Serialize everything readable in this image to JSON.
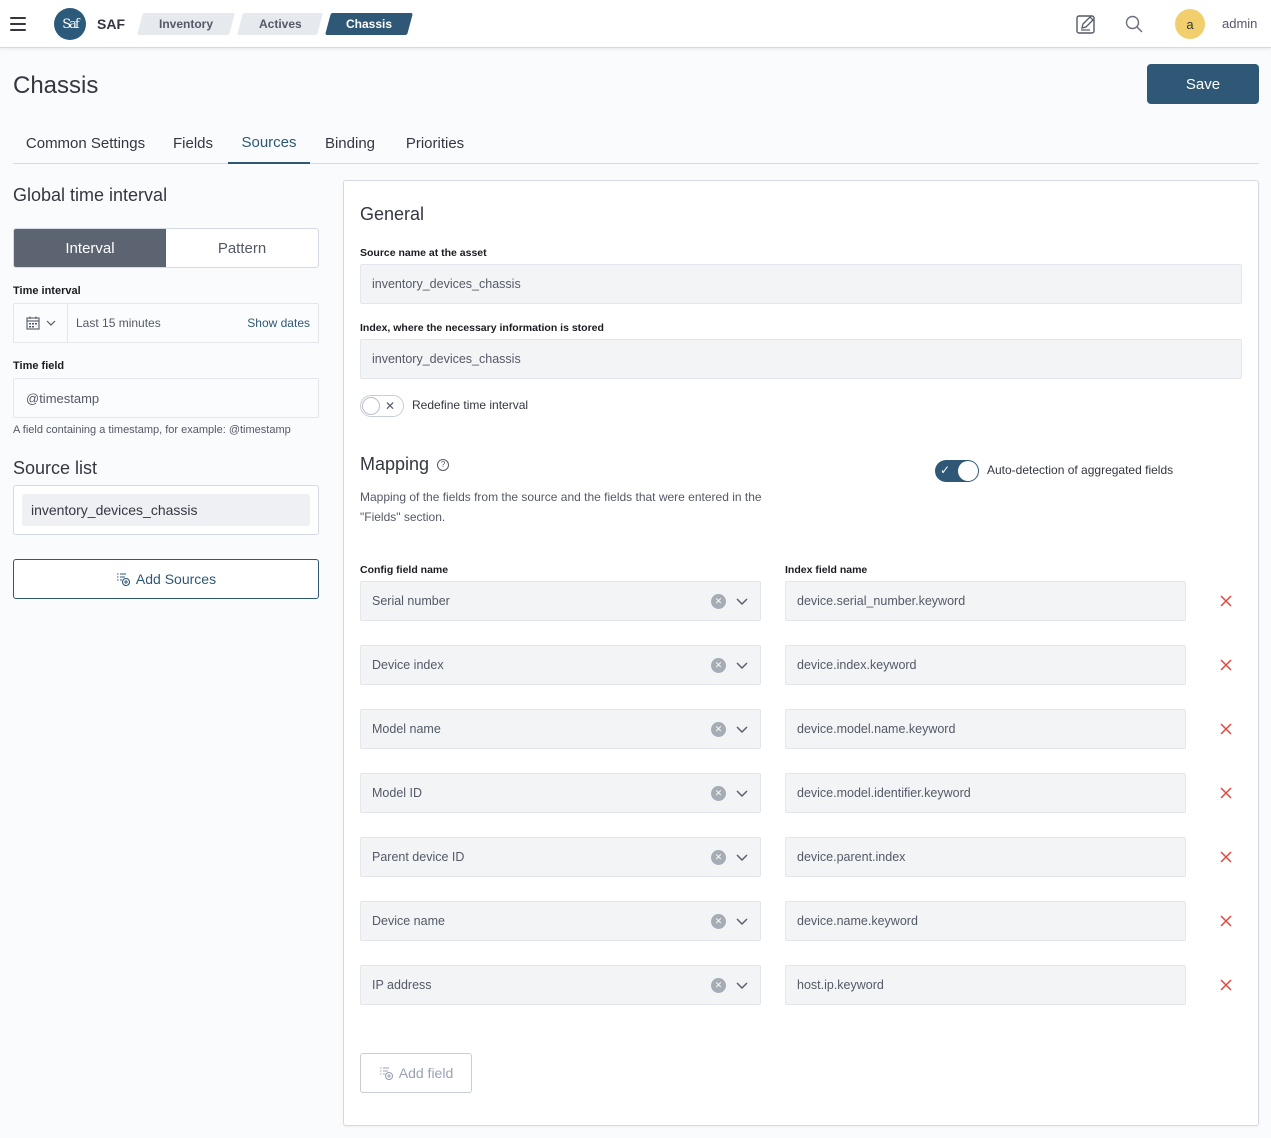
{
  "header": {
    "app_name": "SAF",
    "logo_text": "Saf",
    "breadcrumbs": [
      "Inventory",
      "Actives",
      "Chassis"
    ],
    "user_initial": "a",
    "username": "admin",
    "icons": [
      "menu-icon",
      "edit-icon",
      "search-icon"
    ]
  },
  "page": {
    "title": "Chassis",
    "save_label": "Save",
    "tabs": [
      "Common Settings",
      "Fields",
      "Sources",
      "Binding",
      "Priorities"
    ],
    "active_tab": "Sources"
  },
  "left": {
    "global_time_title": "Global time interval",
    "segments": [
      "Interval",
      "Pattern"
    ],
    "active_segment": "Interval",
    "time_interval_label": "Time interval",
    "time_interval_value": "Last 15 minutes",
    "show_dates": "Show dates",
    "time_field_label": "Time field",
    "time_field_value": "@timestamp",
    "time_field_help": "A field containing a timestamp, for example: @timestamp",
    "source_list_title": "Source list",
    "sources": [
      "inventory_devices_chassis"
    ],
    "add_sources_label": "Add Sources"
  },
  "general": {
    "title": "General",
    "source_name_label": "Source name at the asset",
    "source_name_value": "inventory_devices_chassis",
    "index_label": "Index, where the necessary information is stored",
    "index_value": "inventory_devices_chassis",
    "redefine_label": "Redefine time interval",
    "redefine_on": false
  },
  "mapping": {
    "title": "Mapping",
    "auto_detect_label": "Auto-detection of aggregated fields",
    "auto_detect_on": true,
    "description": "Mapping of the fields from the source and the fields that were entered in the \"Fields\" section.",
    "config_col_label": "Config field name",
    "index_col_label": "Index field name",
    "rows": [
      {
        "config": "Serial number",
        "index": "device.serial_number.keyword"
      },
      {
        "config": "Device index",
        "index": "device.index.keyword"
      },
      {
        "config": "Model name",
        "index": "device.model.name.keyword"
      },
      {
        "config": "Model ID",
        "index": "device.model.identifier.keyword"
      },
      {
        "config": "Parent device ID",
        "index": "device.parent.index"
      },
      {
        "config": "Device name",
        "index": "device.name.keyword"
      },
      {
        "config": "IP address",
        "index": "host.ip.keyword"
      }
    ],
    "add_field_label": "Add field"
  },
  "colors": {
    "accent": "#2f5876",
    "danger": "#e0463f",
    "avatar": "#f0cf6c"
  }
}
